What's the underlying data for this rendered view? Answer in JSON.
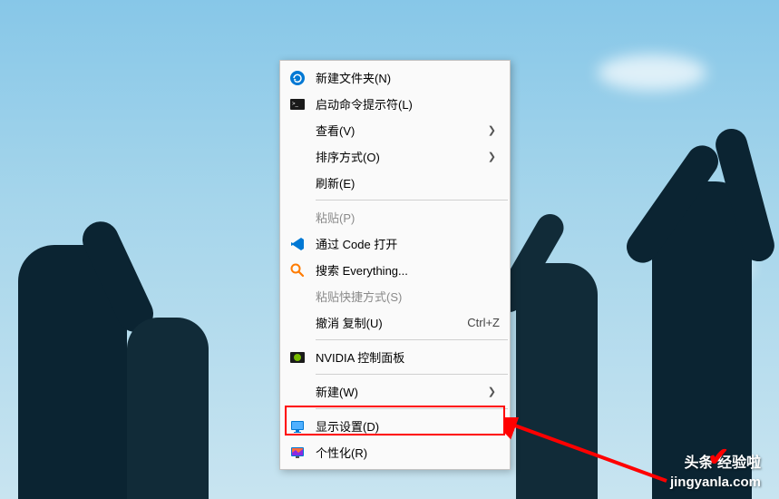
{
  "menu": {
    "items": [
      {
        "label": "新建文件夹(N)",
        "icon": "refresh-circle-icon"
      },
      {
        "label": "启动命令提示符(L)",
        "icon": "terminal-icon"
      },
      {
        "label": "查看(V)",
        "submenu": true
      },
      {
        "label": "排序方式(O)",
        "submenu": true
      },
      {
        "label": "刷新(E)"
      },
      {
        "separator": true
      },
      {
        "label": "粘贴(P)",
        "disabled": true
      },
      {
        "label": "通过 Code 打开",
        "icon": "vscode-icon"
      },
      {
        "label": "搜索 Everything...",
        "icon": "search-icon"
      },
      {
        "label": "粘贴快捷方式(S)",
        "disabled": true
      },
      {
        "label": "撤消 复制(U)",
        "shortcut": "Ctrl+Z"
      },
      {
        "separator": true
      },
      {
        "label": "NVIDIA 控制面板",
        "icon": "nvidia-icon"
      },
      {
        "separator": true
      },
      {
        "label": "新建(W)",
        "submenu": true
      },
      {
        "separator": true
      },
      {
        "label": "显示设置(D)",
        "icon": "display-icon",
        "highlighted": true
      },
      {
        "label": "个性化(R)",
        "icon": "personalize-icon"
      }
    ]
  },
  "watermark": {
    "brand": "头条 经验啦",
    "url": "jingyanla.com"
  }
}
